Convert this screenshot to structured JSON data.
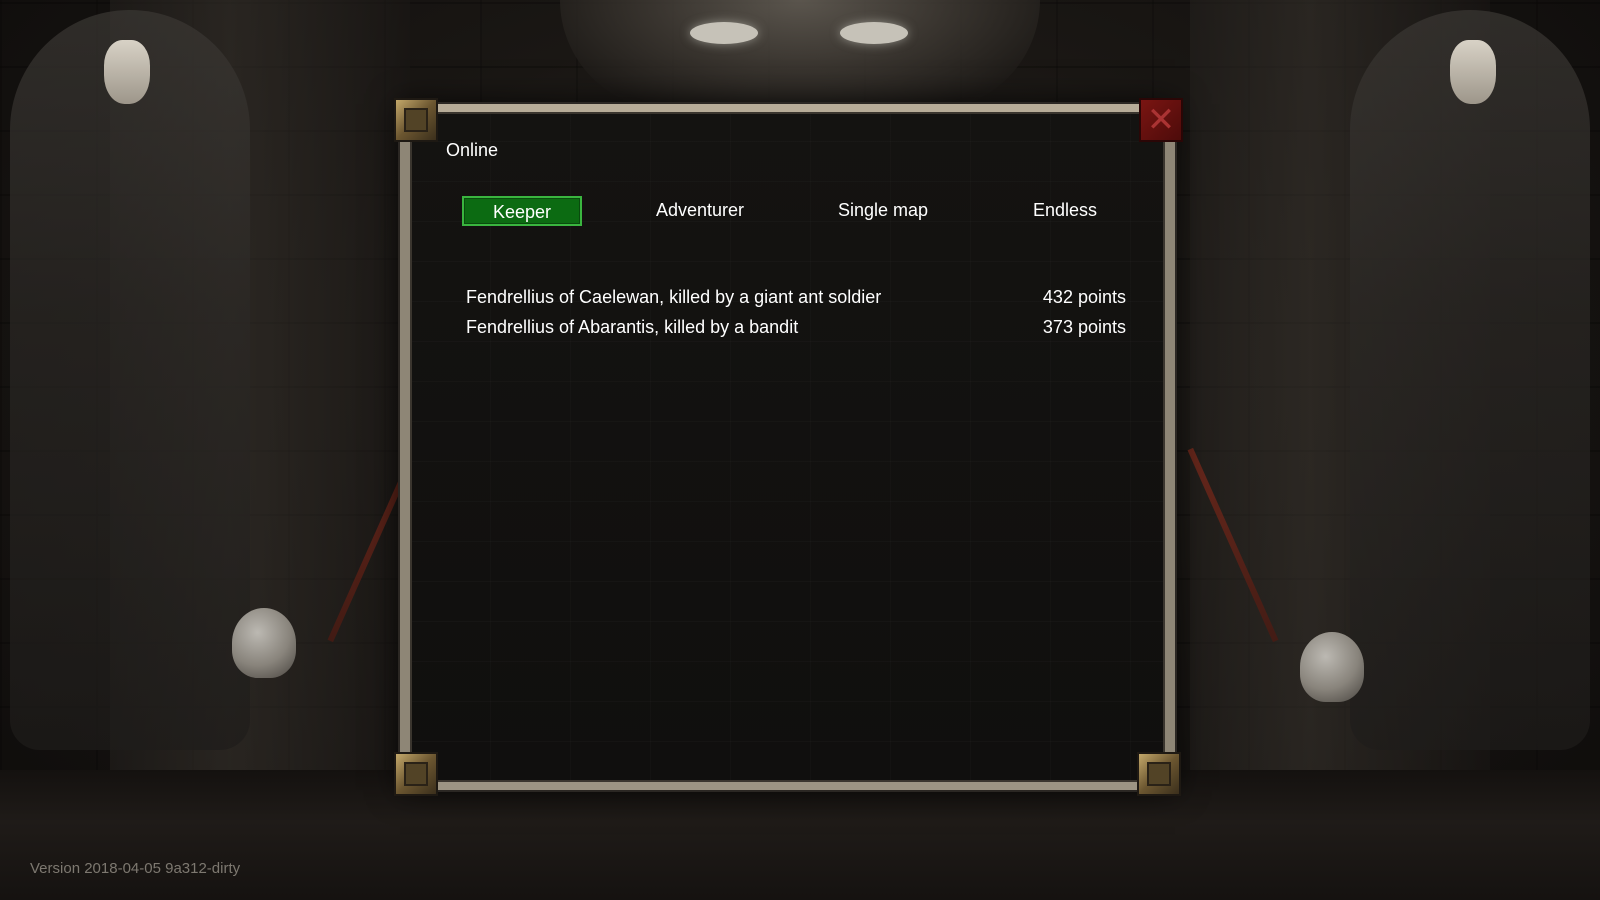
{
  "dialog": {
    "title": "Online",
    "close_icon": "close-icon"
  },
  "tabs": [
    {
      "label": "Keeper",
      "active": true
    },
    {
      "label": "Adventurer",
      "active": false
    },
    {
      "label": "Single map",
      "active": false
    },
    {
      "label": "Endless",
      "active": false
    }
  ],
  "scores": [
    {
      "name": "Fendrellius of Caelewan, killed by a giant ant soldier",
      "points": "432 points"
    },
    {
      "name": "Fendrellius of Abarantis, killed by a bandit",
      "points": "373 points"
    }
  ],
  "footer": {
    "version": "Version 2018-04-05 9a312-dirty"
  },
  "colors": {
    "active_tab_bg": "#0c6b12",
    "active_tab_border": "#3ab53f",
    "close_button": "#7a1512",
    "frame": "#b7ac98"
  }
}
